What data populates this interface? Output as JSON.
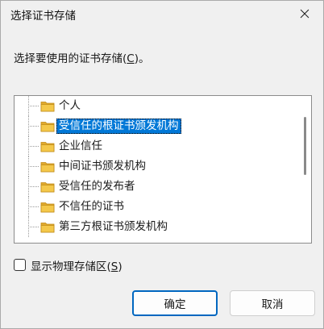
{
  "window": {
    "title": "选择证书存储",
    "close_icon": "close-icon"
  },
  "prompt": {
    "text": "选择要使用的证书存储(",
    "accesskey": "C",
    "suffix": ")。"
  },
  "tree": {
    "items": [
      {
        "label": "个人",
        "icon": "folder-icon",
        "selected": false
      },
      {
        "label": "受信任的根证书颁发机构",
        "icon": "folder-icon",
        "selected": true
      },
      {
        "label": "企业信任",
        "icon": "folder-icon",
        "selected": false
      },
      {
        "label": "中间证书颁发机构",
        "icon": "folder-icon",
        "selected": false
      },
      {
        "label": "受信任的发布者",
        "icon": "folder-icon",
        "selected": false
      },
      {
        "label": "不信任的证书",
        "icon": "folder-icon",
        "selected": false
      },
      {
        "label": "第三方根证书颁发机构",
        "icon": "folder-icon",
        "selected": false
      }
    ]
  },
  "show_physical": {
    "label": "显示物理存储区(",
    "accesskey": "S",
    "suffix": ")",
    "checked": false
  },
  "buttons": {
    "ok": "确定",
    "cancel": "取消"
  },
  "colors": {
    "selection": "#0078d7",
    "default_button_border": "#0067c0",
    "folder": "#f4c84a"
  }
}
